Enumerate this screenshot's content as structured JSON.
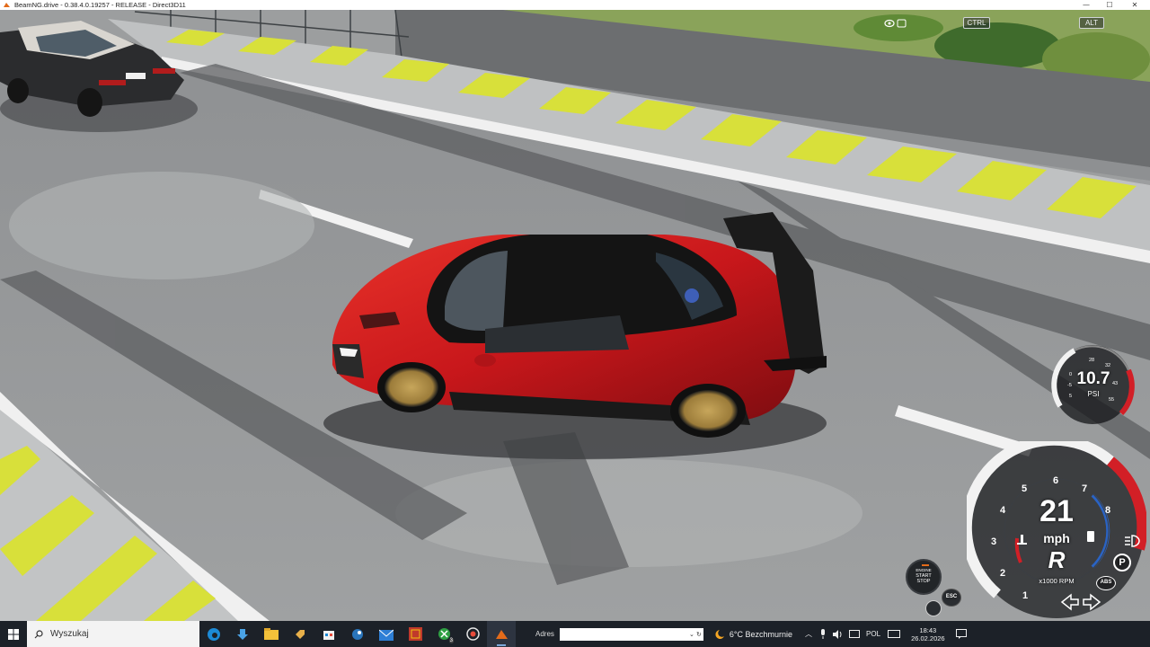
{
  "window": {
    "title": "BeamNG.drive - 0.38.4.0.19257 - RELEASE - Direct3D11",
    "minimize": "—",
    "maximize": "☐",
    "close": "✕"
  },
  "key_hints": {
    "ctrl": "CTRL",
    "alt": "ALT"
  },
  "hud": {
    "boost_value": "10.7",
    "boost_unit": "PSI",
    "boost_ticks": [
      "-5",
      "0",
      "5",
      "28",
      "32",
      "43",
      "55"
    ],
    "speed": "21",
    "speed_unit": "mph",
    "gear": "R",
    "rpm_label": "x1000 RPM",
    "rpm_ticks": [
      "1",
      "2",
      "3",
      "4",
      "5",
      "6",
      "7",
      "8"
    ],
    "start_stop": [
      "ENGINE",
      "START",
      "STOP"
    ],
    "esc_label": "ESC",
    "abs_label": "ABS",
    "park_label": "P"
  },
  "taskbar": {
    "search_placeholder": "Wyszukaj",
    "address_label": "Adres",
    "weather": "6°C  Bezchmurnie",
    "language": "POL",
    "time": "18:43",
    "date": "26.02.2026",
    "xbox_badge": "3"
  },
  "colors": {
    "car_body": "#c8171b",
    "road": "#8a8c8e",
    "hazard_yellow": "#d8e03a",
    "taskbar": "#1c2128",
    "gauge_red": "#d21f26",
    "gauge_blue": "#2a63c4"
  }
}
